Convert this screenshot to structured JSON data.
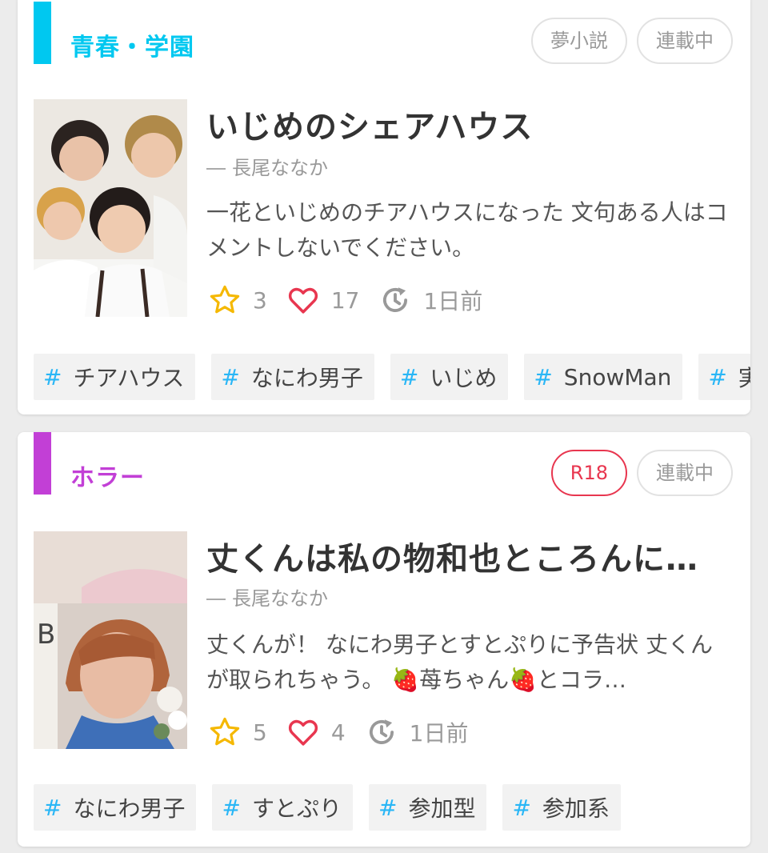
{
  "stories": [
    {
      "genre": "青春・学園",
      "genre_color": "#00c8f0",
      "badges": [
        "夢小説",
        "連載中"
      ],
      "title": "いじめのシェアハウス",
      "author": "長尾ななか",
      "description": "一花といじめのチアハウスになった 文句ある人はコメントしないでください。",
      "stars": "3",
      "likes": "17",
      "updated": "1日前",
      "tags": [
        "チアハウス",
        "なにわ男子",
        "いじめ",
        "SnowMan",
        "実"
      ]
    },
    {
      "genre": "ホラー",
      "genre_color": "#c23fd6",
      "badges": [
        "R18",
        "連載中"
      ],
      "title": "丈くんは私の物和也ところんに…",
      "author": "長尾ななか",
      "description": "丈くんが！ なにわ男子とすとぷりに予告状 丈くんが取られちゃう。 🍓苺ちゃん🍓とコラ…",
      "stars": "5",
      "likes": "4",
      "updated": "1日前",
      "tags": [
        "なにわ男子",
        "すとぷり",
        "参加型",
        "参加系"
      ]
    }
  ],
  "icons": {
    "star": "star-icon",
    "heart": "heart-icon",
    "updated": "history-clock-icon"
  },
  "colors": {
    "star": "#f5b800",
    "heart": "#e8364f",
    "clock": "#999999",
    "hash": "#29b6f6"
  }
}
